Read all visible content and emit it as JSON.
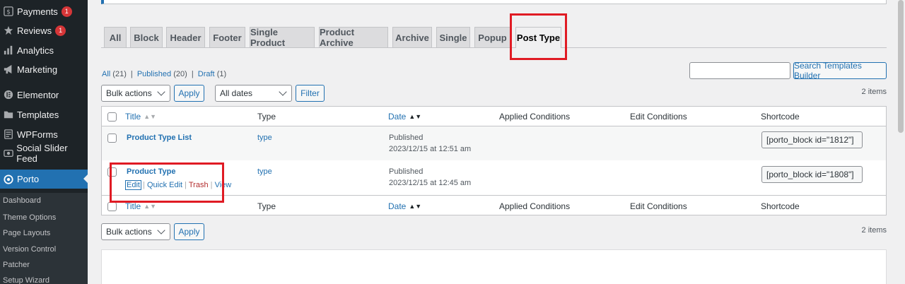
{
  "sidebar": {
    "items": [
      {
        "label": "Payments",
        "badge": "1",
        "icon": "dollar-icon"
      },
      {
        "label": "Reviews",
        "badge": "1",
        "icon": "star-icon"
      },
      {
        "label": "Analytics",
        "icon": "bar-chart-icon"
      },
      {
        "label": "Marketing",
        "icon": "megaphone-icon"
      },
      {
        "label": "Elementor",
        "icon": "elementor-icon"
      },
      {
        "label": "Templates",
        "icon": "folder-icon"
      },
      {
        "label": "WPForms",
        "icon": "form-icon"
      },
      {
        "label": "Social Slider Feed",
        "icon": "slider-icon"
      },
      {
        "label": "Porto",
        "icon": "porto-icon"
      }
    ],
    "submenu": [
      "Dashboard",
      "Theme Options",
      "Page Layouts",
      "Version Control",
      "Patcher",
      "Setup Wizard"
    ]
  },
  "tabs": [
    "All",
    "Block",
    "Header",
    "Footer",
    "Single Product",
    "Product Archive",
    "Archive",
    "Single",
    "Popup",
    "Post Type"
  ],
  "filters": {
    "all": "All",
    "all_count": "(21)",
    "published": "Published",
    "published_count": "(20)",
    "draft": "Draft",
    "draft_count": "(1)",
    "sep": "|"
  },
  "toolbar": {
    "bulk_actions": "Bulk actions",
    "apply": "Apply",
    "all_dates": "All dates",
    "filter": "Filter",
    "search_button": "Search Templates Builder",
    "items_count": "2 items"
  },
  "table": {
    "columns": {
      "title": "Title",
      "type": "Type",
      "date": "Date",
      "applied_conditions": "Applied Conditions",
      "edit_conditions": "Edit Conditions",
      "shortcode": "Shortcode"
    },
    "rows": [
      {
        "title": "Product Type List",
        "type": "type",
        "status": "Published",
        "date": "2023/12/15 at 12:51 am",
        "shortcode": "[porto_block id=\"1812\"]"
      },
      {
        "title": "Product Type",
        "type": "type",
        "status": "Published",
        "date": "2023/12/15 at 12:45 am",
        "shortcode": "[porto_block id=\"1808\"]"
      }
    ],
    "row_actions": {
      "edit": "Edit",
      "quick_edit": "Quick Edit",
      "trash": "Trash",
      "view": "View",
      "sep": "|"
    }
  },
  "colors": {
    "accent": "#2271b1",
    "highlight": "#e01b24",
    "sidebar": "#1d2327"
  }
}
